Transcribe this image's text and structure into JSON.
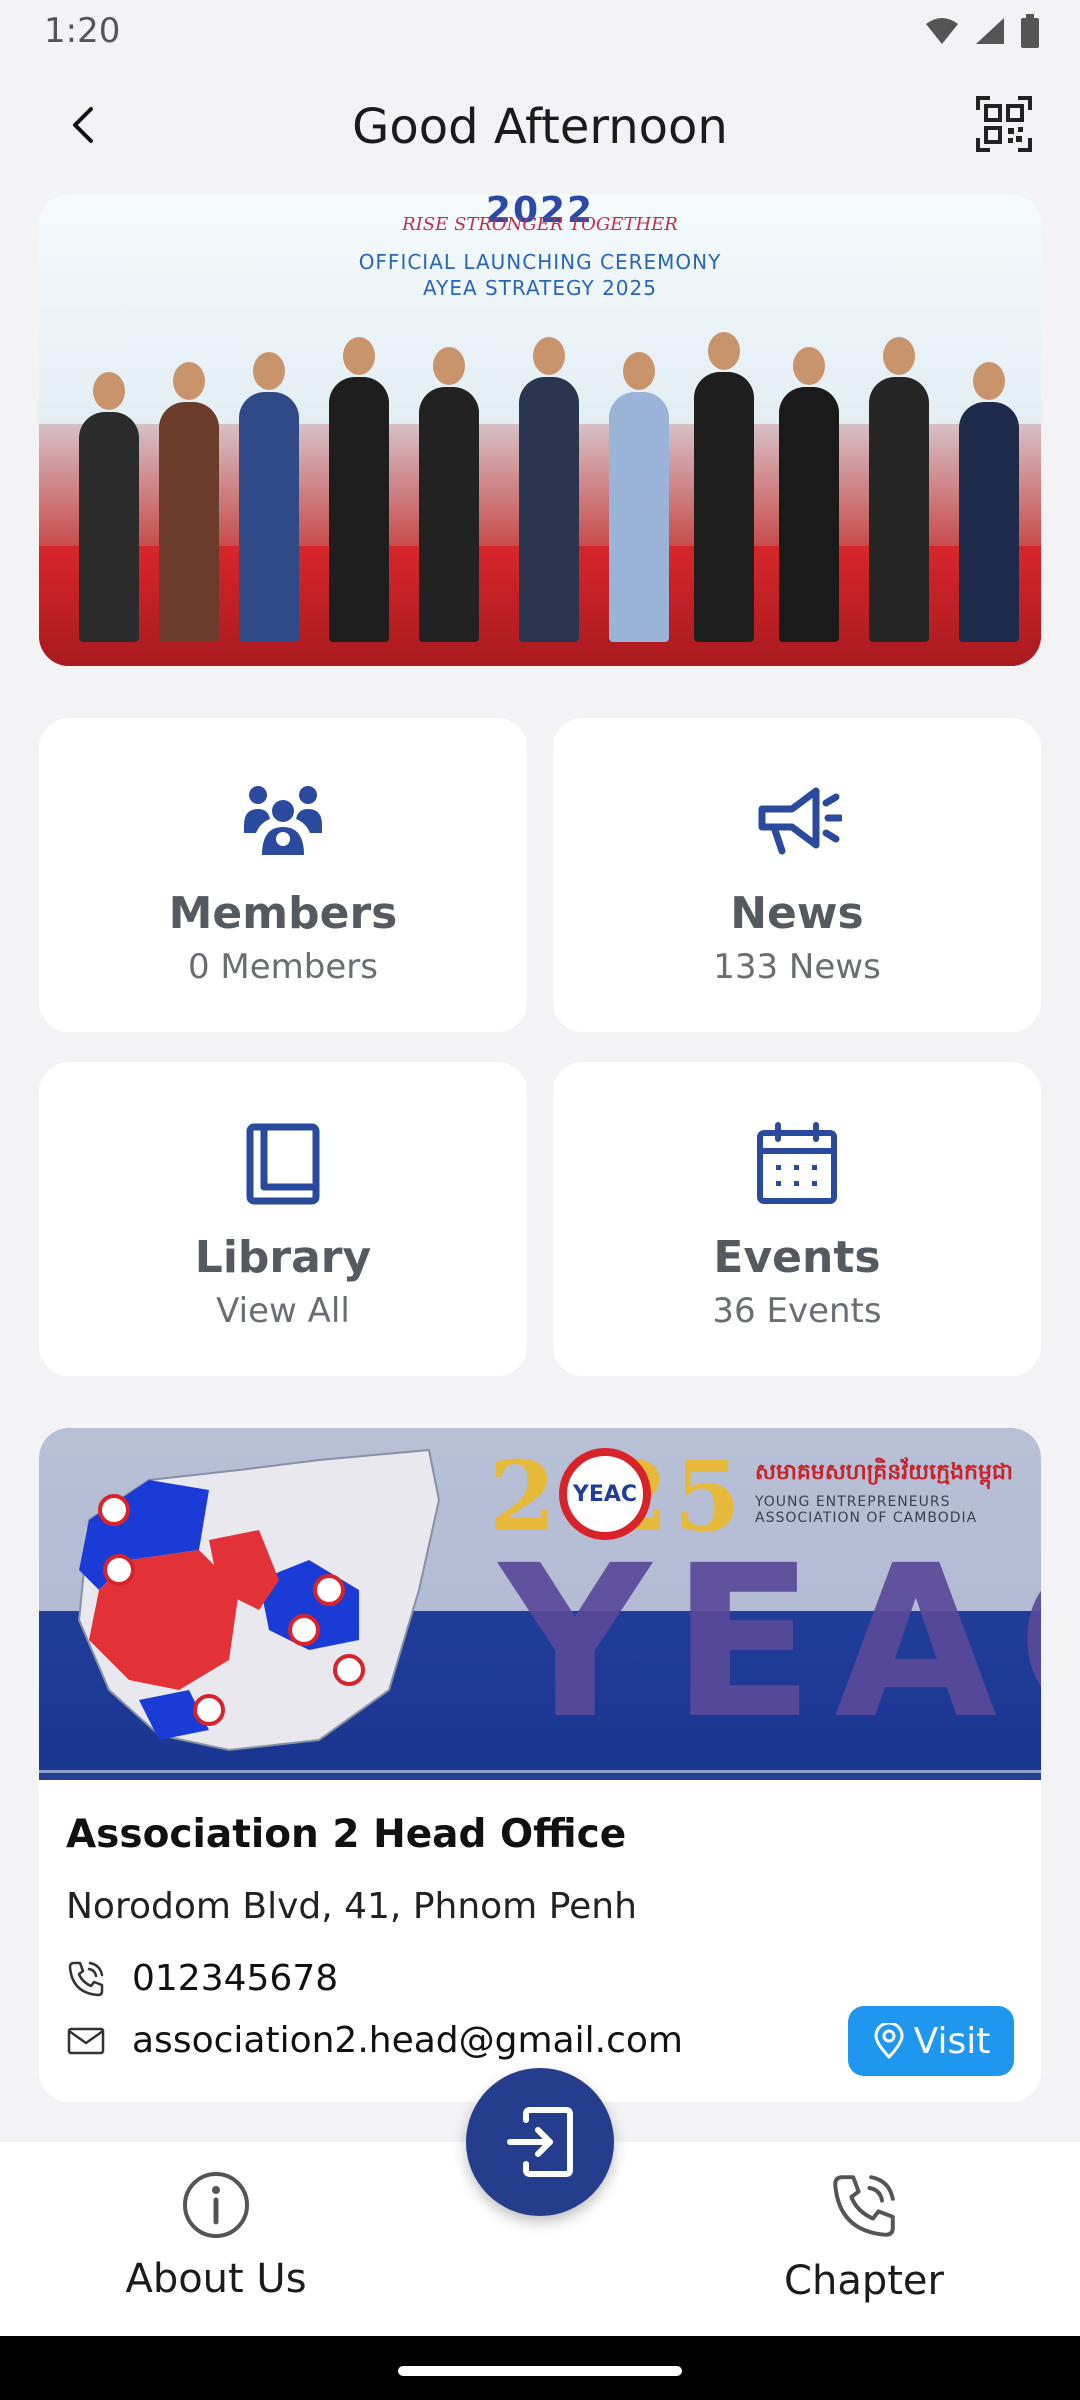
{
  "status_bar": {
    "time": "1:20"
  },
  "header": {
    "title": "Good Afternoon"
  },
  "hero": {
    "year": "2022",
    "tagline": "RISE STRONGER TOGETHER",
    "line1": "OFFICIAL LAUNCHING CEREMONY",
    "line2": "AYEA STRATEGY 2025"
  },
  "cards": [
    {
      "title": "Members",
      "subtitle": "0 Members",
      "icon": "members-icon"
    },
    {
      "title": "News",
      "subtitle": "133 News",
      "icon": "megaphone-icon"
    },
    {
      "title": "Library",
      "subtitle": "View All",
      "icon": "book-icon"
    },
    {
      "title": "Events",
      "subtitle": "36 Events",
      "icon": "calendar-icon"
    }
  ],
  "association": {
    "banner_year": "2  25",
    "banner_logo": "YEAC",
    "banner_kh": "សមាគមសហគ្រិនវ័យក្មេងកម្ពុជា",
    "banner_en": "YOUNG ENTREPRENEURS ASSOCIATION OF CAMBODIA",
    "banner_big": "YEAC",
    "name": "Association 2 Head Office",
    "address": "Norodom Blvd, 41, Phnom Penh",
    "phone": "012345678",
    "email": "association2.head@gmail.com",
    "visit_label": "Visit"
  },
  "bottom_nav": {
    "about_label": "About Us",
    "chapter_label": "Chapter"
  },
  "colors": {
    "accent": "#243d8c",
    "icon_blue": "#2a4a9e",
    "visit_button": "#1f97ef"
  }
}
